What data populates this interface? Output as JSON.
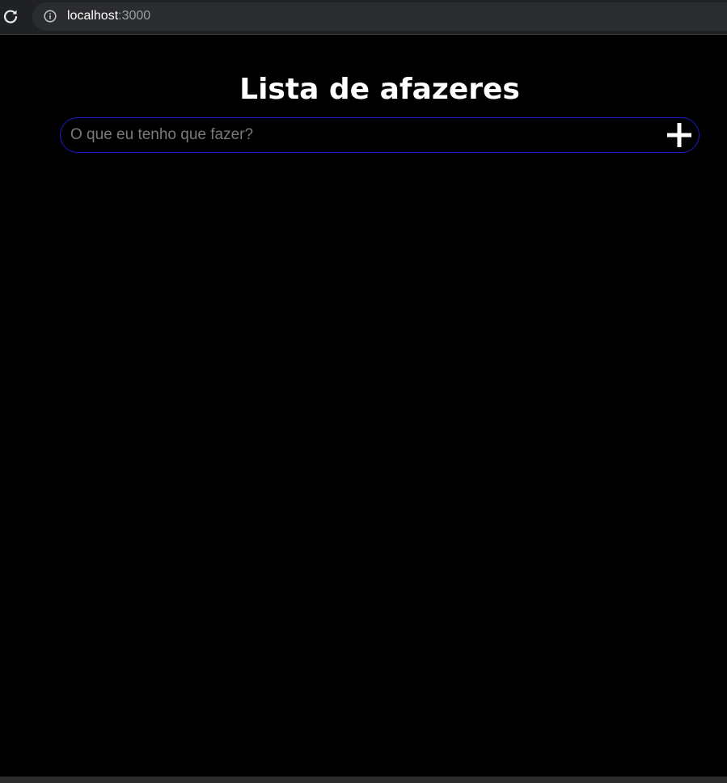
{
  "browser": {
    "url_host": "localhost",
    "url_port": ":3000",
    "icons": {
      "reload": "reload-icon",
      "info": "info-icon"
    }
  },
  "app": {
    "title": "Lista de afazeres",
    "input": {
      "placeholder": "O que eu tenho que fazer?",
      "value": ""
    },
    "add_button_icon": "plus-icon",
    "colors": {
      "background": "#000000",
      "input_border": "#1b1bcc",
      "text": "#ffffff",
      "placeholder": "#7a7a7a"
    }
  }
}
